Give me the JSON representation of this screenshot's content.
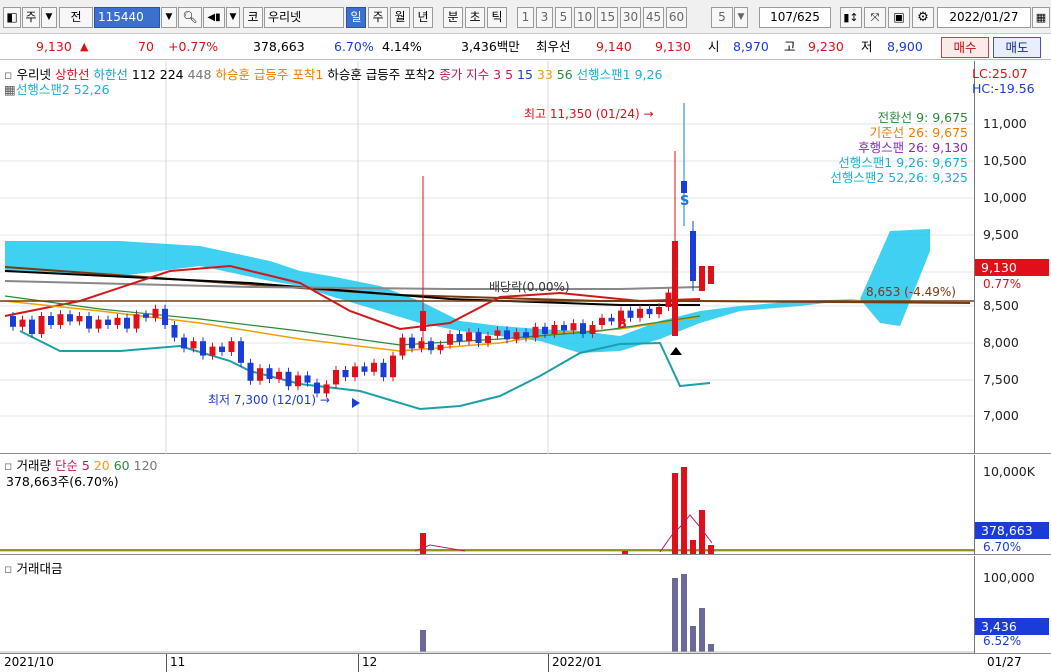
{
  "toolbar": {
    "stock_label": "주",
    "jeon_label": "전",
    "code": "115440",
    "market": "코",
    "stock_name": "우리넷",
    "periods": [
      "일",
      "주",
      "월",
      "년",
      "분",
      "초",
      "틱"
    ],
    "selected_period": "일",
    "intervals": [
      "1",
      "3",
      "5",
      "10",
      "15",
      "30",
      "45",
      "60"
    ],
    "interval_value": "5",
    "count": "107/625",
    "date": "2022/01/27",
    "icons": [
      "chart-type-icon",
      "search-icon",
      "volume-icon",
      "compare-icon",
      "crosshair-icon",
      "save-icon",
      "gear-icon",
      "calendar-icon"
    ]
  },
  "info": {
    "price": "9,130",
    "change": "70",
    "change_pct": "+0.77%",
    "volume": "378,663",
    "vol_pct": "6.70%",
    "turnover": "4.14%",
    "amount": "3,436백만",
    "ask_label": "최우선",
    "ask": "9,140",
    "bid": "9,130",
    "open_label": "시",
    "open": "8,970",
    "high_label": "고",
    "high": "9,230",
    "low_label": "저",
    "low": "8,900",
    "buy_btn": "매수",
    "sell_btn": "매도"
  },
  "price_panel": {
    "legend": [
      {
        "text": "우리넷",
        "color": "#000000"
      },
      {
        "text": "상한선",
        "color": "#e0101a"
      },
      {
        "text": "하한선",
        "color": "#1a9ad8"
      },
      {
        "text": "112",
        "color": "#000000"
      },
      {
        "text": "224",
        "color": "#000000"
      },
      {
        "text": "448",
        "color": "#777777"
      },
      {
        "text": "하승훈 급등주 포착1",
        "color": "#f07a00"
      },
      {
        "text": "하승훈 급등주 포착2",
        "color": "#000000"
      },
      {
        "text": "종가 지수 3",
        "color": "#c2185b"
      },
      {
        "text": "5",
        "color": "#c2185b"
      },
      {
        "text": "15",
        "color": "#1a3cd8"
      },
      {
        "text": "33",
        "color": "#f0a000"
      },
      {
        "text": "56",
        "color": "#2a8a3a"
      },
      {
        "text": "선행스팬1 9,26",
        "color": "#1ab0d8"
      }
    ],
    "legend2": "선행스팬2 52,26",
    "lc": "LC:25.07",
    "hc": "HC:-19.56",
    "y_ticks": [
      "11,000",
      "10,500",
      "10,000",
      "9,500",
      "9,000",
      "8,500",
      "8,000",
      "7,500",
      "7,000"
    ],
    "ichimoku": [
      {
        "text": "전환선 9: 9,675",
        "color": "#2a8a3a"
      },
      {
        "text": "기준선 26: 9,675",
        "color": "#f07a00"
      },
      {
        "text": "후행스팬 26: 9,130",
        "color": "#8a2ab8"
      },
      {
        "text": "선행스팬1 9,26: 9,675",
        "color": "#1ab0d8"
      },
      {
        "text": "선행스팬2 52,26: 9,325",
        "color": "#1ab0d8"
      }
    ],
    "high_note": "최고 11,350 (01/24)",
    "low_note": "최저 7,300 (12/01)",
    "current_price": "9,130",
    "current_pct": "0.77%",
    "avg_line": "8,653 (-4.49%)",
    "vdrag_label": "배당락(0.00%)",
    "signal_s": "S",
    "signal_b": "B"
  },
  "volume_panel": {
    "legend": [
      {
        "text": "거래량",
        "color": "#000000"
      },
      {
        "text": "단순 5",
        "color": "#c2185b"
      },
      {
        "text": "20",
        "color": "#f0a000"
      },
      {
        "text": "60",
        "color": "#2a8a3a"
      },
      {
        "text": "120",
        "color": "#777777"
      }
    ],
    "sub": "378,663주(6.70%)",
    "tick": "10,000K",
    "current": "378,663",
    "pct": "6.70%"
  },
  "amount_panel": {
    "legend": "거래대금",
    "tick": "100,000",
    "current": "3,436",
    "pct": "6.52%"
  },
  "dates": [
    "2021/10",
    "11",
    "12",
    "2022/01",
    "01/27"
  ],
  "colors": {
    "up": "#e0101a",
    "down": "#1a3cd8",
    "cloud": "#1ec8f0",
    "amount_bar": "#6a6a9a"
  }
}
